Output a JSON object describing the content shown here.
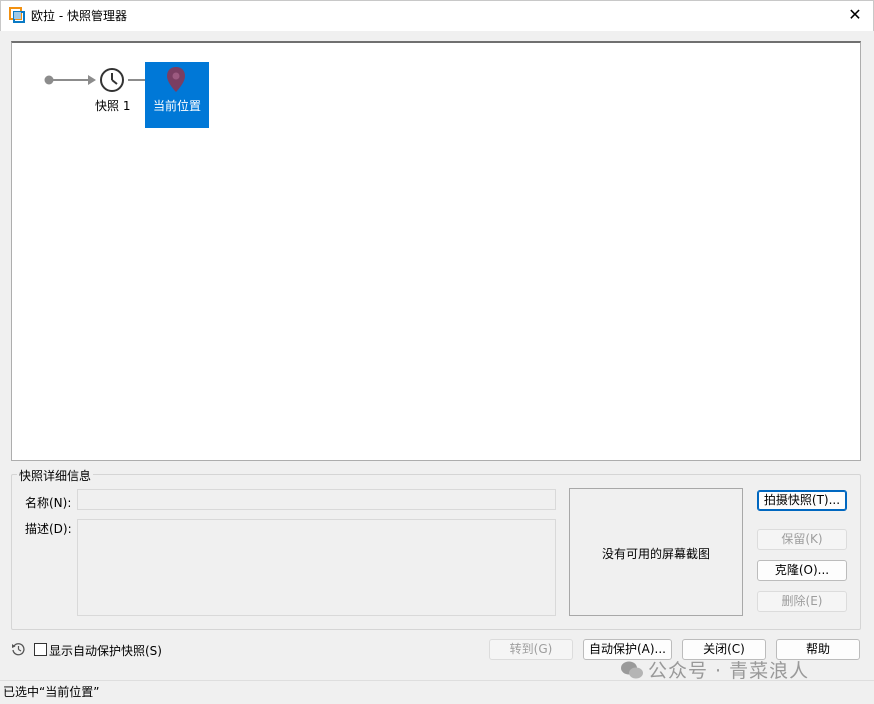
{
  "window": {
    "title": "欧拉 - 快照管理器"
  },
  "tree": {
    "snapshot_label": "快照 1",
    "current_label": "当前位置",
    "selected_color": "#0078d7"
  },
  "details": {
    "group_title": "快照详细信息",
    "name_label": "名称(N):",
    "desc_label": "描述(D):",
    "name_value": "",
    "desc_value": "",
    "preview_text": "没有可用的屏幕截图"
  },
  "side_buttons": {
    "take_snapshot": "拍摄快照(T)...",
    "keep": "保留(K)",
    "clone": "克隆(O)...",
    "delete": "删除(E)"
  },
  "bottom": {
    "show_autoprotect": "显示自动保护快照(S)",
    "goto": "转到(G)",
    "autoprotect": "自动保护(A)...",
    "close": "关闭(C)",
    "help": "帮助"
  },
  "status": {
    "text": "已选中“当前位置”"
  },
  "watermark": {
    "text": "公众号 · 青菜浪人"
  }
}
